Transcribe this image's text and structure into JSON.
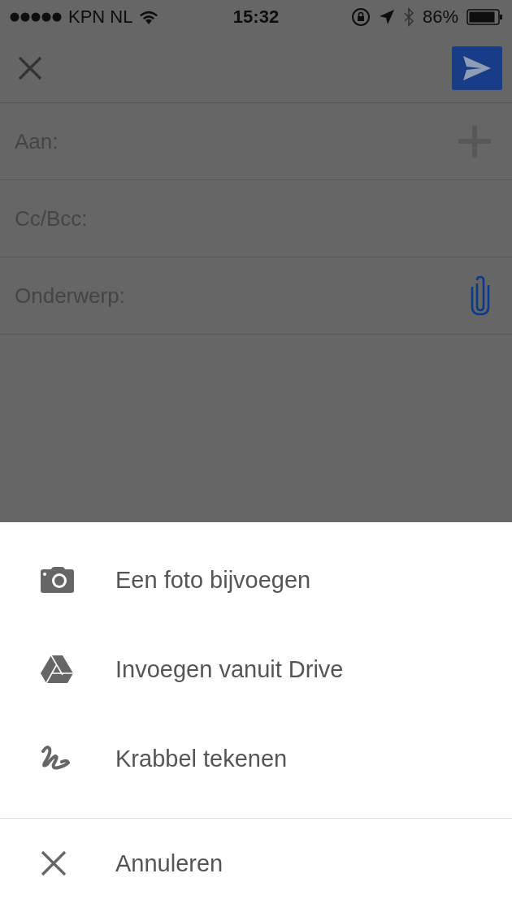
{
  "status_bar": {
    "carrier": "KPN NL",
    "time": "15:32",
    "battery": "86%"
  },
  "fields": [
    {
      "label": "Aan:",
      "kind": "add"
    },
    {
      "label": "Cc/Bcc:",
      "kind": "plain"
    },
    {
      "label": "Onderwerp:",
      "kind": "attach"
    }
  ],
  "action_sheet": {
    "items": [
      {
        "label": "Een foto bijvoegen",
        "kind": "action"
      },
      {
        "label": "Invoegen vanuit Drive",
        "kind": "action"
      },
      {
        "label": "Krabbel tekenen",
        "kind": "action"
      },
      {
        "label": "Annuleren",
        "kind": "cancel"
      }
    ]
  }
}
